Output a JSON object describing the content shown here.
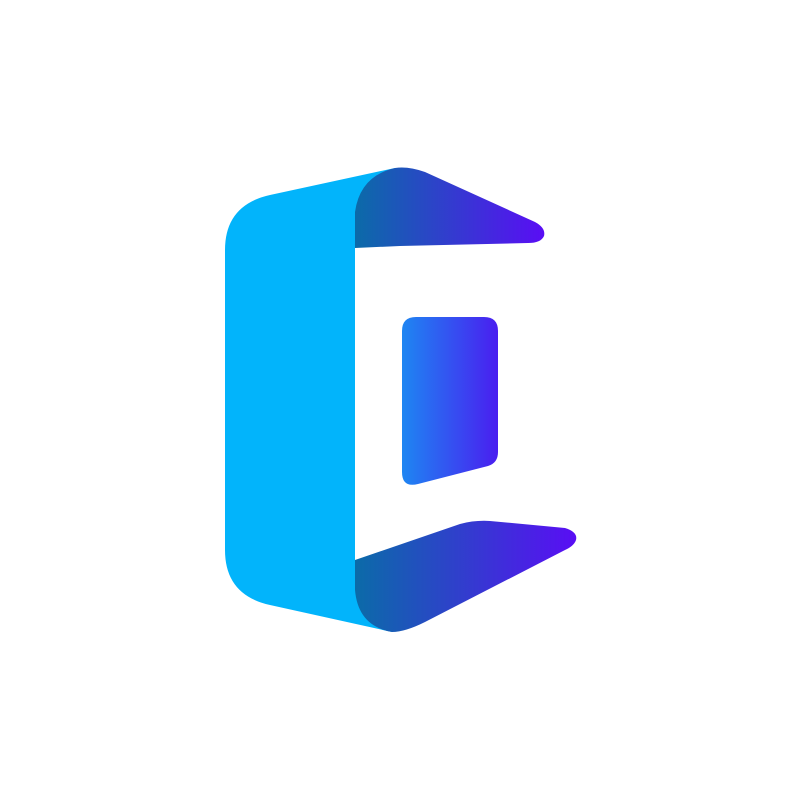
{
  "logo": {
    "icon": "folded-ribbon-c-logo-icon",
    "colors": {
      "ribbon_main": "#02B4FB",
      "fold_dark": "#0B6BA8",
      "fold_end": "#5A0DF5",
      "panel_start": "#1E86F2",
      "panel_end": "#4A1EF0",
      "background": "#FFFFFF"
    }
  }
}
